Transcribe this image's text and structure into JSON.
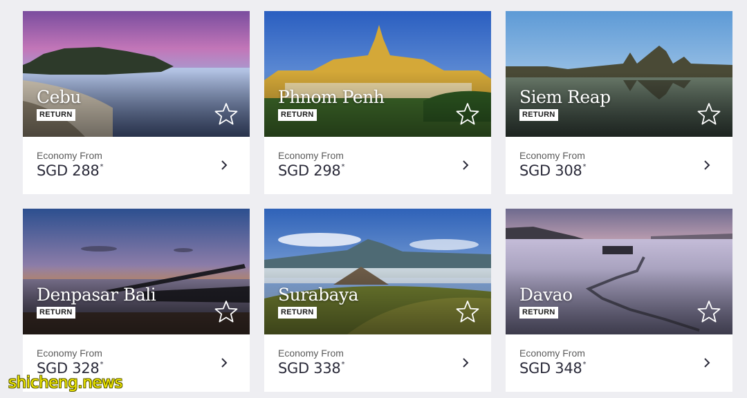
{
  "cards": [
    {
      "city": "Cebu",
      "badge": "RETURN",
      "fare_label": "Economy From",
      "currency": "SGD",
      "price": "288",
      "note": "*"
    },
    {
      "city": "Phnom Penh",
      "badge": "RETURN",
      "fare_label": "Economy From",
      "currency": "SGD",
      "price": "298",
      "note": "*"
    },
    {
      "city": "Siem Reap",
      "badge": "RETURN",
      "fare_label": "Economy From",
      "currency": "SGD",
      "price": "308",
      "note": "*"
    },
    {
      "city": "Denpasar Bali",
      "badge": "RETURN",
      "fare_label": "Economy From",
      "currency": "SGD",
      "price": "328",
      "note": "*"
    },
    {
      "city": "Surabaya",
      "badge": "RETURN",
      "fare_label": "Economy From",
      "currency": "SGD",
      "price": "338",
      "note": "*"
    },
    {
      "city": "Davao",
      "badge": "RETURN",
      "fare_label": "Economy From",
      "currency": "SGD",
      "price": "348",
      "note": "*"
    }
  ],
  "icons": {
    "favorite": "star-outline-icon",
    "open": "chevron-right-icon"
  },
  "watermark": "shicheng.news"
}
